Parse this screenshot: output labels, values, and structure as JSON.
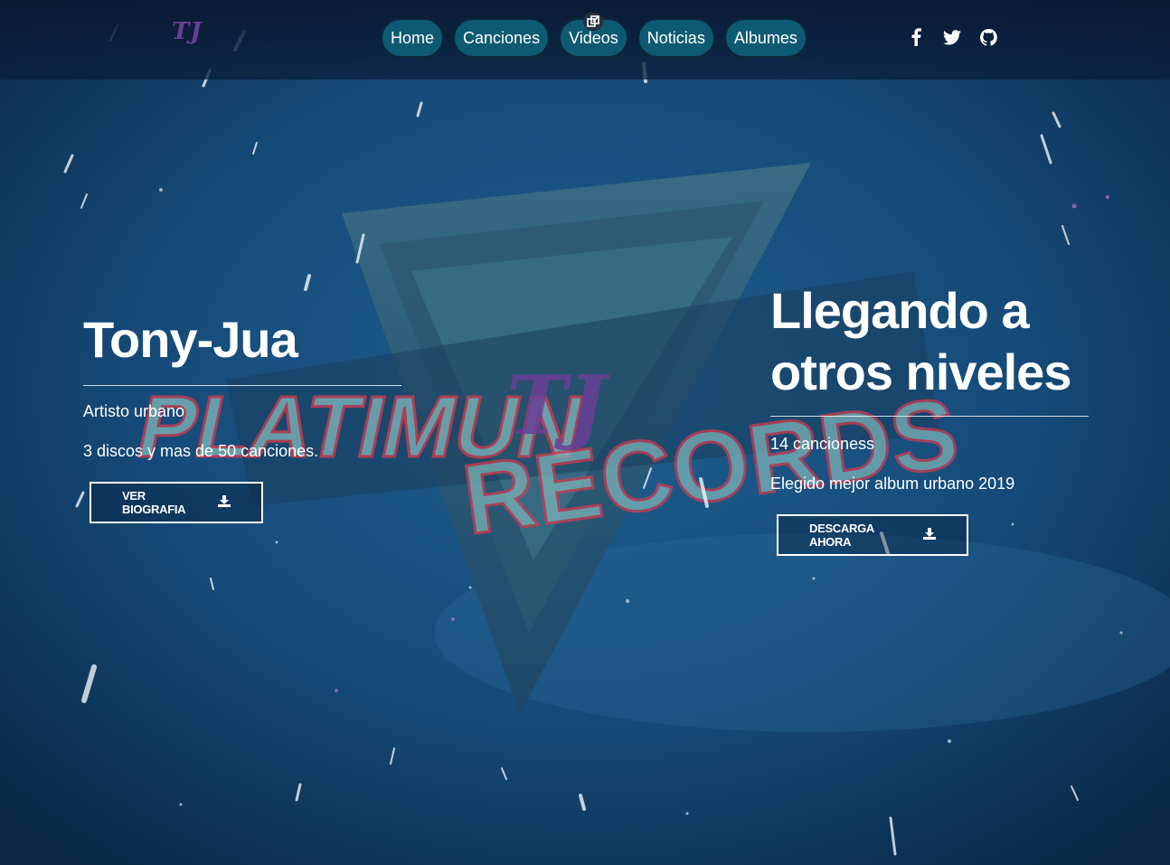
{
  "logo": {
    "text": "TJ"
  },
  "nav": {
    "items": [
      {
        "label": "Home"
      },
      {
        "label": "Canciones"
      },
      {
        "label": "Videos"
      },
      {
        "label": "Noticias"
      },
      {
        "label": "Albumes"
      }
    ]
  },
  "social": {
    "icons": [
      "facebook-icon",
      "twitter-icon",
      "github-icon"
    ]
  },
  "background": {
    "line1": "PLATIMUN",
    "line2": "RECORDS",
    "overlay": "TJ"
  },
  "hero_left": {
    "title": "Tony-Jua",
    "subtitle": "Artisto urbano",
    "detail": "3 discos y mas de 50 canciones.",
    "button_label": "VER BIOGRAFIA"
  },
  "hero_right": {
    "title_line1": "Llegando a",
    "title_line2": "otros niveles",
    "subtitle": "14 cancioness",
    "detail": "Elegido mejor album urbano 2019",
    "button_label": "DESCARGA AHORA"
  },
  "colors": {
    "nav_pill": "#0f5a73",
    "logo": "#6b3f96",
    "background": "#0c2d52"
  }
}
